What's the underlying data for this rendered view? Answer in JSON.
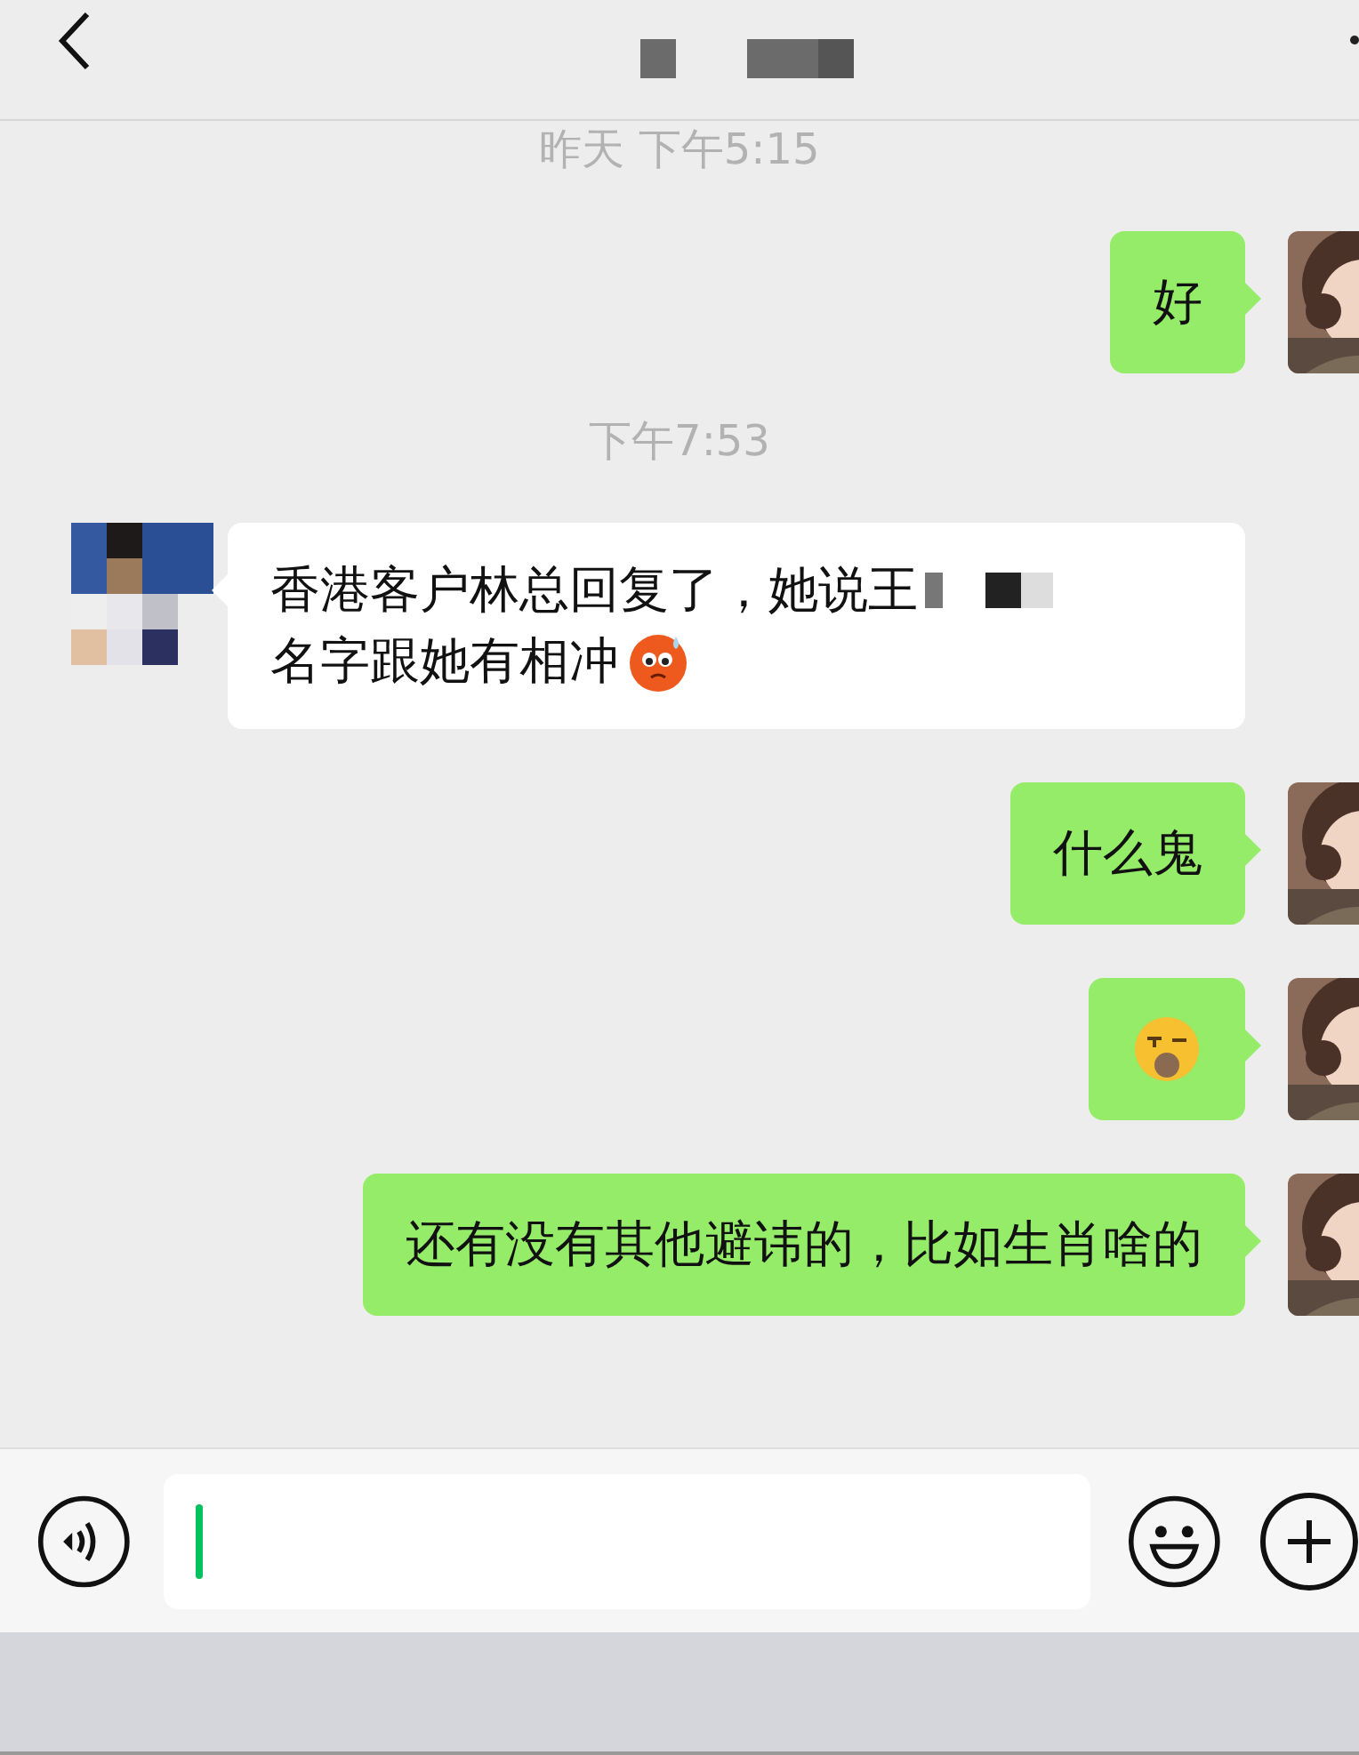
{
  "messages": [
    {
      "kind": "time",
      "text": "昨天 下午5:15"
    },
    {
      "kind": "message",
      "outgoing": true,
      "lines": [
        [
          {
            "kind": "text",
            "text": "好"
          }
        ]
      ]
    },
    {
      "kind": "time",
      "text": "下午7:53"
    },
    {
      "kind": "message",
      "outgoing": false,
      "lines": [
        [
          {
            "kind": "text",
            "text": "香港客户林总回复了，她说王"
          },
          {
            "kind": "redacted"
          }
        ],
        [
          {
            "kind": "text",
            "text": "名字跟她有相冲"
          },
          {
            "kind": "anxious"
          }
        ]
      ]
    },
    {
      "kind": "message",
      "outgoing": true,
      "lines": [
        [
          {
            "kind": "text",
            "text": "什么鬼"
          }
        ]
      ]
    },
    {
      "kind": "message",
      "outgoing": true,
      "lines": [
        [
          {
            "kind": "sleepy"
          }
        ]
      ]
    },
    {
      "kind": "message",
      "outgoing": true,
      "lines": [
        [
          {
            "kind": "text",
            "text": "还有没有其他避讳的，比如生肖啥的"
          }
        ]
      ]
    }
  ],
  "input": {
    "focused": true
  }
}
